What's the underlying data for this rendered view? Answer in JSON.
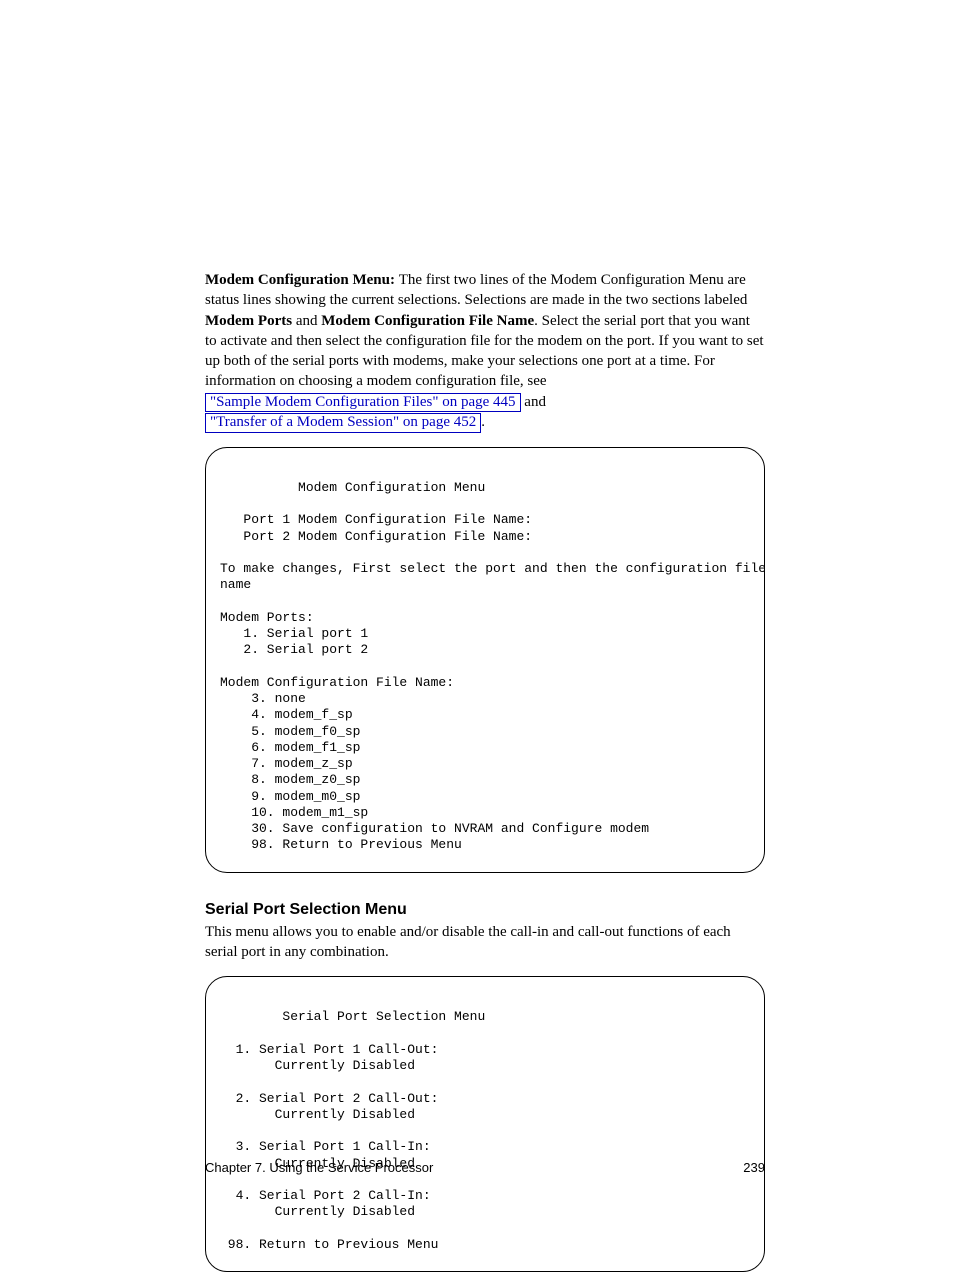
{
  "intro": {
    "lead_bold": "Modem Configuration Menu: ",
    "lead_rest": "The first two lines of the Modem Configuration Menu are status lines showing the current selections. Selections are made in the two sections labeled ",
    "label1": "Modem Ports",
    "mid": " and ",
    "label2": "Modem Configuration File Name",
    "tail_a": ". Select the serial port that you want to activate and then select the configuration file for the modem on the port. If you want to set up both of the serial ports with modems, make your selections one port at a time. For information on choosing a modem configuration file, see ",
    "link1": "\"Sample Modem Configuration Files\" on page 445",
    "and": " and ",
    "link2": "\"Transfer of a Modem Session\" on page 452",
    "period": "."
  },
  "terminal1": {
    "title": "          Modem Configuration Menu",
    "l1": "   Port 1 Modem Configuration File Name:",
    "l2": "   Port 2 Modem Configuration File Name:",
    "l3": "To make changes, First select the port and then the configuration file",
    "l4": "name",
    "h1": "Modem Ports:",
    "p1": "   1. Serial port 1",
    "p2": "   2. Serial port 2",
    "h2": "Modem Configuration File Name:",
    "c3": "    3. none",
    "c4": "    4. modem_f_sp",
    "c5": "    5. modem_f0_sp",
    "c6": "    6. modem_f1_sp",
    "c7": "    7. modem_z_sp",
    "c8": "    8. modem_z0_sp",
    "c9": "    9. modem_m0_sp",
    "c10": "    10. modem_m1_sp",
    "c30": "    30. Save configuration to NVRAM and Configure modem",
    "c98": "    98. Return to Previous Menu"
  },
  "section": {
    "heading": "Serial Port Selection Menu",
    "para": "This menu allows you to enable and/or disable the call-in and call-out functions of each serial port in any combination."
  },
  "terminal2": {
    "title": "        Serial Port Selection Menu",
    "i1a": "  1. Serial Port 1 Call-Out:",
    "i1b": "       Currently Disabled",
    "i2a": "  2. Serial Port 2 Call-Out:",
    "i2b": "       Currently Disabled",
    "i3a": "  3. Serial Port 1 Call-In:",
    "i3b": "       Currently Disabled",
    "i4a": "  4. Serial Port 2 Call-In:",
    "i4b": "       Currently Disabled",
    "i98": " 98. Return to Previous Menu"
  },
  "footer": {
    "left": "",
    "right": "Chapter 7. Using the Service Processor",
    "page": "239"
  }
}
